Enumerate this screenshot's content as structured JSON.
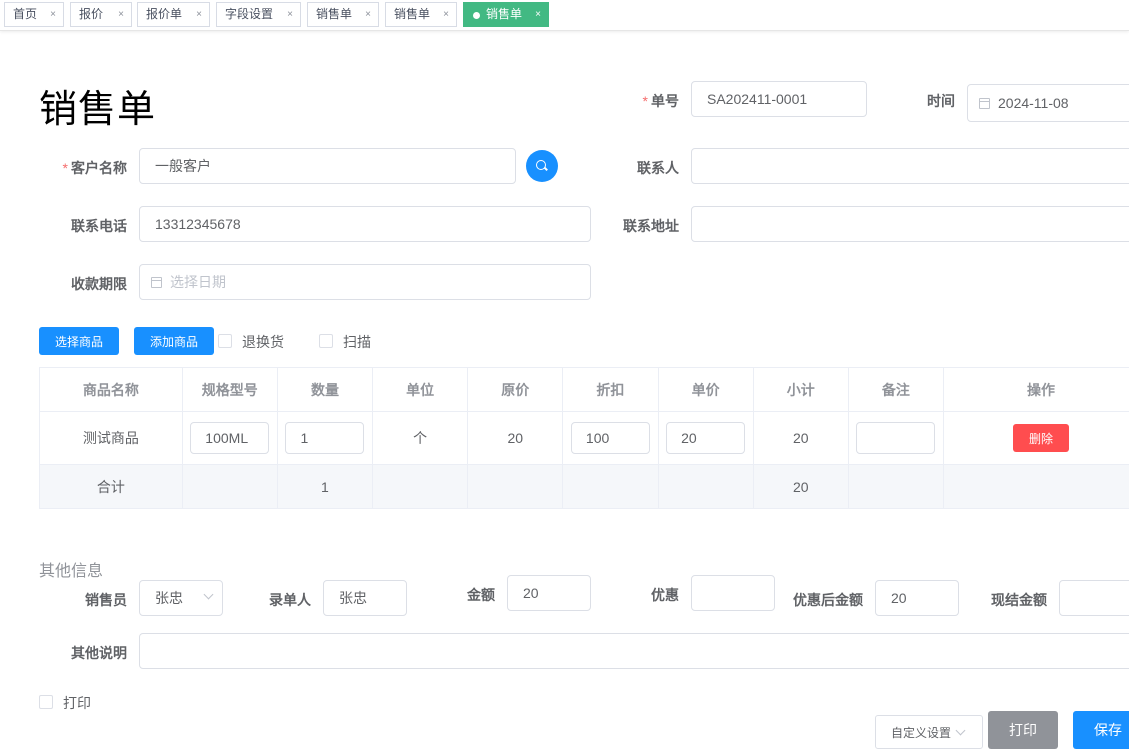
{
  "tabs": [
    {
      "label": "首页",
      "active": false
    },
    {
      "label": "报价",
      "active": false
    },
    {
      "label": "报价单",
      "active": false
    },
    {
      "label": "字段设置",
      "active": false
    },
    {
      "label": "销售单",
      "active": false
    },
    {
      "label": "销售单",
      "active": false
    },
    {
      "label": "销售单",
      "active": true
    }
  ],
  "tab_close": "×",
  "page_title": "销售单",
  "form": {
    "order_no_label": "单号",
    "order_no_value": "SA202411-0001",
    "time_label": "时间",
    "time_value": "2024-11-08",
    "customer_label": "客户名称",
    "customer_value": "一般客户",
    "contact_label": "联系人",
    "contact_value": "",
    "phone_label": "联系电话",
    "phone_value": "13312345678",
    "address_label": "联系地址",
    "address_value": "",
    "due_label": "收款期限",
    "due_placeholder": "选择日期",
    "required_mark": "*"
  },
  "toolbar": {
    "select_goods": "选择商品",
    "add_goods": "添加商品",
    "return_label": "退换货",
    "scan_label": "扫描"
  },
  "table": {
    "headers": [
      "商品名称",
      "规格型号",
      "数量",
      "单位",
      "原价",
      "折扣",
      "单价",
      "小计",
      "备注",
      "操作"
    ],
    "row": {
      "name": "测试商品",
      "spec": "100ML",
      "qty": "1",
      "unit": "个",
      "orig_price": "20",
      "discount": "100",
      "price": "20",
      "subtotal": "20",
      "remark": "",
      "delete": "删除"
    },
    "summary": {
      "label": "合计",
      "qty": "1",
      "subtotal": "20"
    }
  },
  "other": {
    "section_title": "其他信息",
    "salesman_label": "销售员",
    "salesman_value": "张忠",
    "recorder_label": "录单人",
    "recorder_value": "张忠",
    "amount_label": "金额",
    "amount_value": "20",
    "discount_label": "优惠",
    "discount_value": "",
    "after_discount_label": "优惠后金额",
    "after_discount_value": "20",
    "cash_label": "现结金额",
    "cash_value": "",
    "note_label": "其他说明",
    "note_value": "",
    "print_check_label": "打印"
  },
  "footer": {
    "custom_settings": "自定义设置",
    "print": "打印",
    "save": "保存"
  },
  "colors": {
    "primary": "#1890ff",
    "active_tab": "#42b983",
    "danger": "#ff4d4f",
    "print_button": "#909399"
  }
}
